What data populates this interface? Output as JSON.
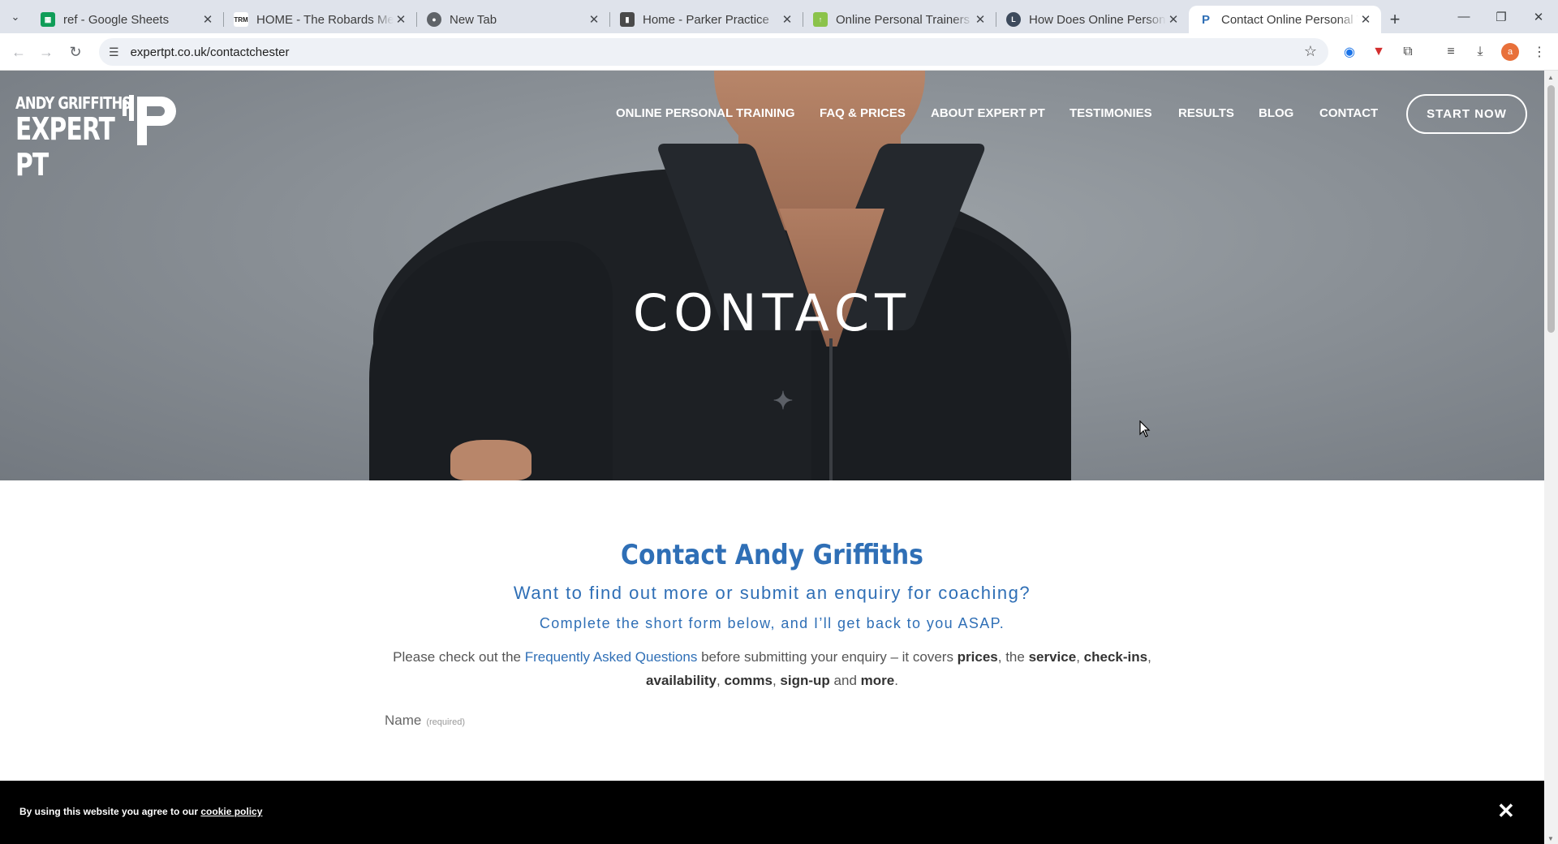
{
  "browser": {
    "tabs": [
      {
        "title": "ref - Google Sheets",
        "favicon": "sheets-icon",
        "color": "#0f9d58",
        "active": false
      },
      {
        "title": "HOME - The Robards Method",
        "favicon": "trm-icon",
        "color": "#222222",
        "active": false
      },
      {
        "title": "New Tab",
        "favicon": "chrome-icon",
        "color": "#5f6368",
        "active": false
      },
      {
        "title": "Home - Parker Practice",
        "favicon": "parker-icon",
        "color": "#4a4a4a",
        "active": false
      },
      {
        "title": "Online Personal Trainers - Fitne",
        "favicon": "fitness-icon",
        "color": "#8bc34a",
        "active": false
      },
      {
        "title": "How Does Online Personal Trai",
        "favicon": "l-icon",
        "color": "#3d4a5c",
        "active": false
      },
      {
        "title": "Contact Online Personal Traine",
        "favicon": "p-icon",
        "color": "#2f6fb6",
        "active": true
      }
    ],
    "url": "expertpt.co.uk/contactchester",
    "profile_initial": "a",
    "accent": "#e8703a"
  },
  "site": {
    "logo_line1": "ANDY GRIFFITHS",
    "logo_line2": "EXPERT PT",
    "nav": [
      {
        "label": "ONLINE PERSONAL TRAINING"
      },
      {
        "label": "FAQ & PRICES"
      },
      {
        "label": "ABOUT EXPERT PT"
      },
      {
        "label": "TESTIMONIES"
      },
      {
        "label": "RESULTS"
      },
      {
        "label": "BLOG"
      },
      {
        "label": "CONTACT"
      }
    ],
    "cta": "START NOW"
  },
  "hero": {
    "title": "CONTACT"
  },
  "content": {
    "title": "Contact Andy Griffiths",
    "subtitle": "Want to find out more or submit an enquiry for coaching?",
    "subtitle2": "Complete the short form below, and I’ll get back to you ASAP.",
    "body_prefix": "Please check out the ",
    "faq_link": "Frequently Asked Questions",
    "body_mid": " before submitting your enquiry – it covers ",
    "k1": "prices",
    "t1": ", the ",
    "k2": "service",
    "t2": ", ",
    "k3": "check-ins",
    "t3": ",",
    "k4": "availability",
    "t4": ", ",
    "k5": "comms",
    "t5": ", ",
    "k6": "sign-up",
    "t6": " and ",
    "k7": "more",
    "t7": ".",
    "name_label": "Name",
    "name_required": "(required)"
  },
  "cookie": {
    "message": "By using this website you agree to our ",
    "link": "cookie policy",
    "close": "✕"
  },
  "colors": {
    "brand_blue": "#2f6fb6",
    "tabstrip": "#dfe3eb"
  }
}
